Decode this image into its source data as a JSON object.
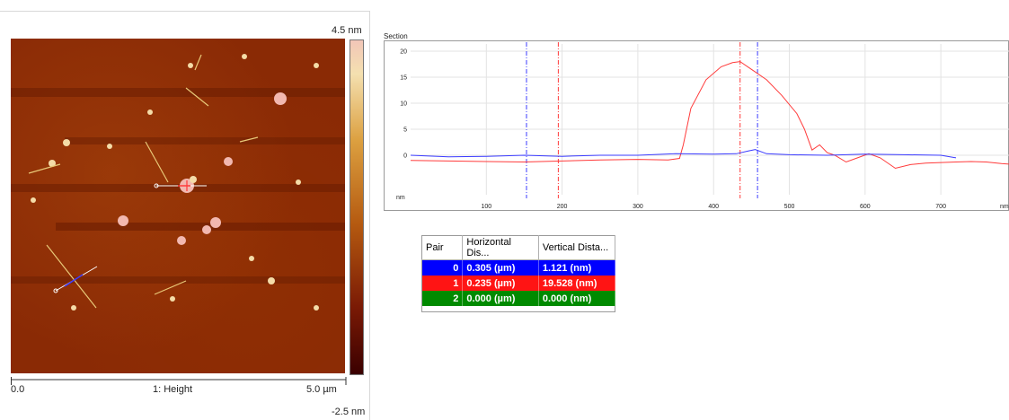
{
  "afm": {
    "scale_max": "4.5 nm",
    "scale_min": "-2.5 nm",
    "x_start": "0.0",
    "x_end": "5.0 µm",
    "channel": "1: Height"
  },
  "section": {
    "title": "Section",
    "y_unit": "nm",
    "x_unit": "nm"
  },
  "chart_data": {
    "type": "line",
    "title": "Section",
    "xlabel": "nm",
    "ylabel": "nm",
    "xlim": [
      0,
      790
    ],
    "ylim": [
      -5,
      20
    ],
    "x_ticks": [
      100,
      200,
      300,
      400,
      500,
      600,
      700
    ],
    "y_ticks": [
      0,
      5,
      10,
      15,
      20
    ],
    "grid": true,
    "series": [
      {
        "color": "#ff3b3b",
        "x": [
          0,
          50,
          100,
          150,
          200,
          250,
          300,
          340,
          355,
          360,
          370,
          390,
          410,
          425,
          435,
          450,
          470,
          490,
          510,
          520,
          530,
          540,
          550,
          560,
          575,
          590,
          605,
          620,
          640,
          660,
          680,
          700,
          720,
          740,
          760,
          780,
          790
        ],
        "y": [
          -1,
          -1.1,
          -1.2,
          -1.3,
          -1.1,
          -0.9,
          -0.8,
          -0.9,
          -0.6,
          2,
          9,
          14.5,
          17,
          17.8,
          18,
          16.5,
          14.5,
          11.5,
          8,
          5,
          1,
          2,
          0.5,
          0,
          -1.3,
          -0.5,
          0.3,
          -0.5,
          -2.5,
          -1.8,
          -1.5,
          -1.4,
          -1.3,
          -1.2,
          -1.3,
          -1.6,
          -1.7
        ]
      },
      {
        "color": "#3b3bff",
        "x": [
          0,
          50,
          100,
          150,
          200,
          250,
          300,
          350,
          400,
          430,
          445,
          455,
          470,
          500,
          550,
          600,
          650,
          700,
          720
        ],
        "y": [
          0,
          -0.3,
          -0.2,
          0,
          -0.2,
          0,
          0,
          0.3,
          0.2,
          0.3,
          0.8,
          1.1,
          0.3,
          0.1,
          0,
          0.2,
          0.1,
          0,
          -0.5
        ]
      }
    ],
    "markers": [
      {
        "x": 153,
        "color": "#3b3bff"
      },
      {
        "x": 195,
        "color": "#ff3b3b"
      },
      {
        "x": 435,
        "color": "#ff3b3b"
      },
      {
        "x": 458,
        "color": "#3b3bff"
      }
    ]
  },
  "table": {
    "headers": [
      "Pair",
      "Horizontal Dis...",
      "Vertical Dista..."
    ],
    "rows": [
      {
        "pair": "0",
        "horizontal": "0.305 (µm)",
        "vertical": "1.121 (nm)",
        "color": "#0000ff"
      },
      {
        "pair": "1",
        "horizontal": "0.235 (µm)",
        "vertical": "19.528 (nm)",
        "color": "#ff1414"
      },
      {
        "pair": "2",
        "horizontal": "0.000 (µm)",
        "vertical": "0.000 (nm)",
        "color": "#008a00"
      }
    ]
  }
}
